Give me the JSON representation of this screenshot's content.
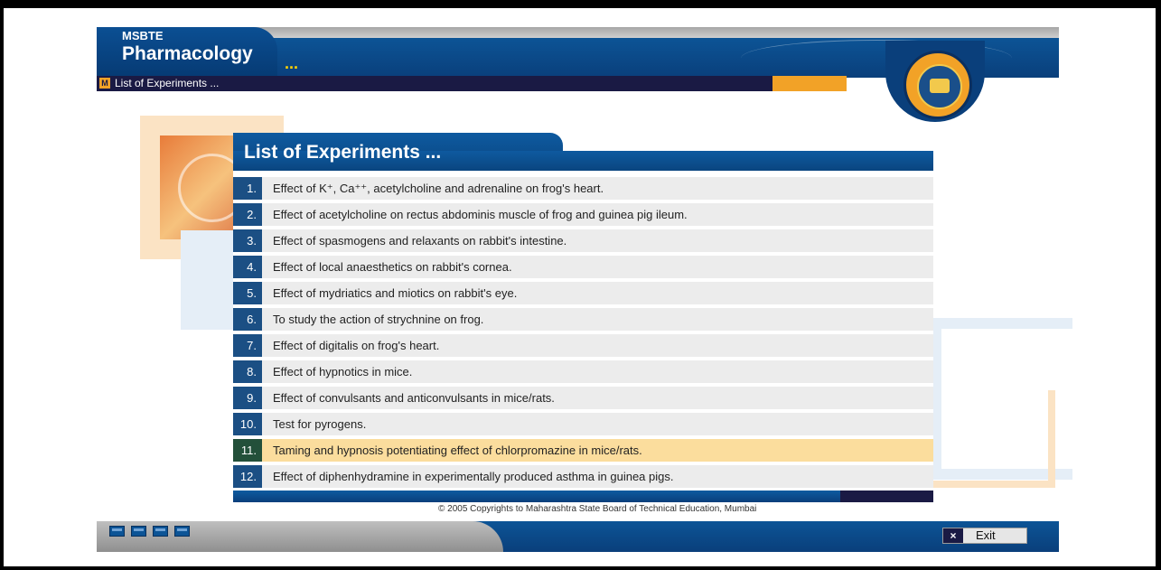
{
  "app": {
    "brand_top": "MSBTE",
    "brand_title": "Pharmacology",
    "brand_dots": "...",
    "breadcrumb": "List of Experiments ...",
    "breadcrumb_icon": "M"
  },
  "panel": {
    "title": "List of Experiments ..."
  },
  "experiments": [
    {
      "num": "1.",
      "label": "Effect of K⁺, Ca⁺⁺, acetylcholine and adrenaline on frog's heart."
    },
    {
      "num": "2.",
      "label": "Effect of acetylcholine on rectus abdominis muscle of frog and guinea pig ileum."
    },
    {
      "num": "3.",
      "label": "Effect of spasmogens and relaxants on rabbit's intestine."
    },
    {
      "num": "4.",
      "label": "Effect of local anaesthetics on rabbit's cornea."
    },
    {
      "num": "5.",
      "label": "Effect of mydriatics and miotics on rabbit's eye."
    },
    {
      "num": "6.",
      "label": "To study the action of strychnine on frog."
    },
    {
      "num": "7.",
      "label": "Effect of digitalis on frog's heart."
    },
    {
      "num": "8.",
      "label": "Effect of hypnotics in mice."
    },
    {
      "num": "9.",
      "label": "Effect of convulsants and anticonvulsants in mice/rats."
    },
    {
      "num": "10.",
      "label": "Test for pyrogens."
    },
    {
      "num": "11.",
      "label": "Taming and hypnosis potentiating effect of chlorpromazine in mice/rats."
    },
    {
      "num": "12.",
      "label": "Effect of diphenhydramine in experimentally produced asthma in guinea pigs."
    }
  ],
  "selected_experiment": "11.",
  "footer": {
    "copyright": "© 2005 Copyrights to Maharashtra State Board of Technical Education, Mumbai",
    "exit_label": "Exit",
    "exit_icon": "close-icon"
  },
  "colors": {
    "primary_blue": "#0a457f",
    "accent_orange": "#f2a227",
    "highlight": "#fbdd9d"
  }
}
